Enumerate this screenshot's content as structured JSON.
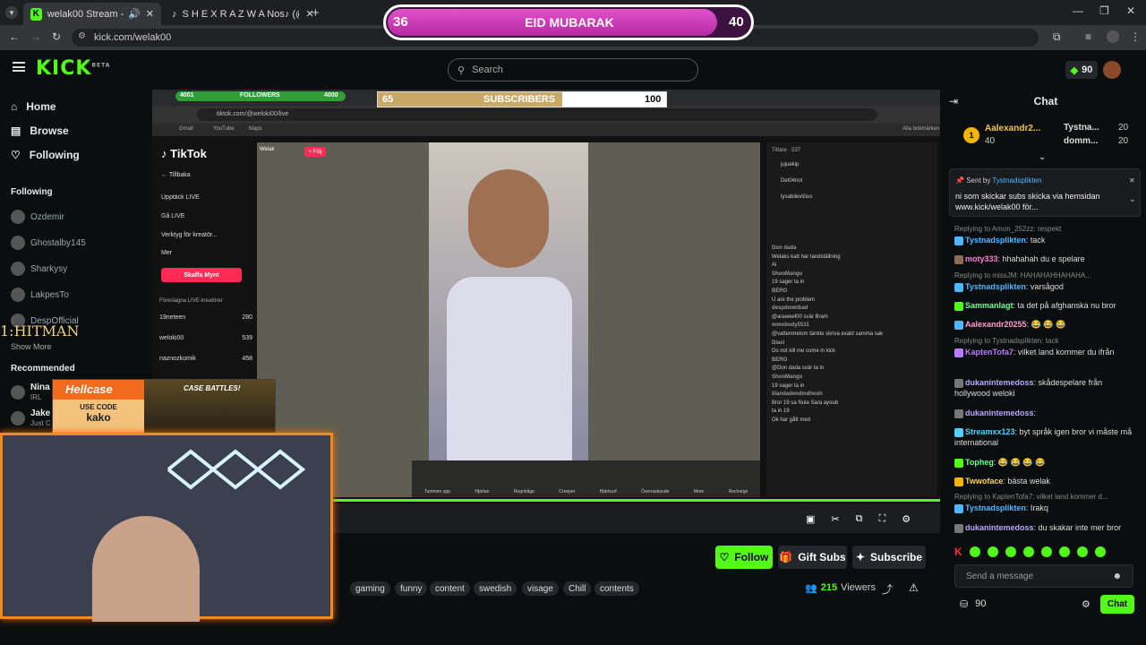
{
  "browser": {
    "tab1": "welak00 Stream - Watch Live",
    "tab2": "S H E X R A Z W A Nos♪ (@she",
    "url": "kick.com/welak00"
  },
  "banner": {
    "left": "36",
    "title": "EID MUBARAK",
    "right": "40"
  },
  "search": {
    "placeholder": "Search"
  },
  "header": {
    "coins": "90"
  },
  "nav": [
    {
      "label": "Home"
    },
    {
      "label": "Browse"
    },
    {
      "label": "Following"
    }
  ],
  "following": {
    "title": "Following",
    "items": [
      "Ozdemir",
      "Ghostalby145",
      "Sharkysy",
      "LakpesTo",
      "DespOfficial"
    ],
    "show_more": "Show More"
  },
  "recommended": {
    "title": "Recommended",
    "items": [
      {
        "name": "Nina",
        "sub": "IRL"
      },
      {
        "name": "Jake",
        "sub": "Just C"
      }
    ]
  },
  "overlay": {
    "followers_left": "4001",
    "followers_label": "FOLLOWERS",
    "followers_right": "4000",
    "subs_left": "65",
    "subs_label": "SUBSCRIBERS",
    "subs_right": "100",
    "hitman": "1:HITMAN",
    "hellcase": "Hellcase",
    "use_code": "USE CODE",
    "code": "kako",
    "case_battles": "CASE BATTLES!"
  },
  "tiktok": {
    "url": "tiktok.com/@weloki00/live",
    "bookmarks": [
      "Gmail",
      "YouTube",
      "Maps"
    ],
    "alla": "Alla bokmärken",
    "brand": "TikTok",
    "back": "Tillbaka",
    "menu": [
      "Upptäck LIVE",
      "Gå LIVE",
      "Verktyg för kreatör...",
      "Mer"
    ],
    "get_coins": "Skaffa Mynt",
    "suggested": "Föreslagna LIVE-kreatörer",
    "creators": [
      {
        "name": "19neteen",
        "count": "280"
      },
      {
        "name": "weloki00",
        "count": "539"
      },
      {
        "name": "naznozkomik",
        "count": "458"
      }
    ],
    "host": "Welak",
    "follow": "+ Följ",
    "viewers_label": "Tittare · 537",
    "viewers": [
      "jujuekip",
      "Det04nol",
      "tysabilevičius"
    ],
    "gifts": [
      "Tummen upp",
      "Hjärtan",
      "Regnbåge",
      "Creeper",
      "Hjärtsurf",
      "Överraskande",
      "More",
      "Recharge"
    ],
    "comments": [
      {
        "u": "Don dada",
        "t": "Welaks katt har tandställning"
      },
      {
        "u": "",
        "t": "Ai"
      },
      {
        "u": "ShooMango",
        "t": "19 sager ta in"
      },
      {
        "u": "BERO",
        "t": "U are the problem"
      },
      {
        "u": "despdownbad",
        "t": "@araweel00 svär Bram"
      },
      {
        "u": "mmobody5511",
        "t": "@vattenmelom tänkte skriva exakt samma sak"
      },
      {
        "u": "Diaci",
        "t": "Do not kill me come in kick"
      },
      {
        "u": "BERO",
        "t": "@Don dada svär ta in"
      },
      {
        "u": "ShooMango",
        "t": "19 sager ta in"
      },
      {
        "u": "lilandadendindhosh",
        "t": "Bror 19 sa Nula Sara ayoub"
      },
      {
        "u": "",
        "t": "ta in 19"
      },
      {
        "u": "",
        "t": "Ok har gått med"
      }
    ]
  },
  "stream": {
    "follow": "Follow",
    "gift": "Gift Subs",
    "subscribe": "Subscribe",
    "tags": [
      "gaming",
      "funny",
      "content",
      "swedish",
      "visage",
      "Chill",
      "contents"
    ],
    "viewers_count": "215",
    "viewers_label": "Viewers"
  },
  "chat": {
    "title": "Chat",
    "top1_name": "Aalexandr2...",
    "top1_val": "40",
    "top2_name": "Tystna...",
    "top2_val": "20",
    "top3_name": "domm...",
    "top3_val": "20",
    "pinned_by": "Sent by",
    "pinned_user": "Tystnadsplikten",
    "pinned_text": "ni som skickar subs skicka via hemsidan www.kick/welak00 för...",
    "messages": [
      {
        "reply": "Replying to Amon_252zz: respekt",
        "user": "Tystnadsplikten",
        "color": "#4fb7ff",
        "text": ": tack"
      },
      {
        "reply": "",
        "user": "moty333",
        "color": "#ff7ad9",
        "text": ": hhahahah du e spelare"
      },
      {
        "reply": "Replying to missJM: HAHAHAHHAHAHA...",
        "user": "Tystnadsplikten",
        "color": "#4fb7ff",
        "text": ": varsågod"
      },
      {
        "reply": "",
        "user": "Sammanlagt",
        "color": "#6cff8f",
        "text": ": ta det på afghanska nu bror"
      },
      {
        "reply": "",
        "user": "Aalexandr20255",
        "color": "#ff9ecf",
        "text": ": 😂 😂 😂"
      },
      {
        "reply": "Replying to Tystnadsplikten: tack",
        "user": "KaptenTofa7",
        "color": "#b97bff",
        "text": ": vilket land kommer du ifrån"
      },
      {
        "reply": "",
        "user": "dukanintemedoss",
        "color": "#b9a7ff",
        "text": ": skådespelare från hollywood weloki"
      },
      {
        "reply": "",
        "user": "dukanintemedoss",
        "color": "#b9a7ff",
        "text": ":"
      },
      {
        "reply": "",
        "user": "Streamxx123",
        "color": "#4fd1ff",
        "text": ": byt språk igen bror vi måste må international"
      },
      {
        "reply": "",
        "user": "Topheg",
        "color": "#6cff8f",
        "text": ": 😂 😂 😂 😂"
      },
      {
        "reply": "",
        "user": "Twwoface",
        "color": "#ffd34f",
        "text": ": bästa welak"
      },
      {
        "reply": "Replying to KaptenTofa7: vilket land kommer d...",
        "user": "Tystnadsplikten",
        "color": "#4fb7ff",
        "text": ": Irakq"
      },
      {
        "reply": "",
        "user": "dukanintemedoss",
        "color": "#b9a7ff",
        "text": ": du skakar inte mer bror"
      }
    ],
    "input_placeholder": "Send a message",
    "points": "90",
    "send_label": "Chat"
  }
}
